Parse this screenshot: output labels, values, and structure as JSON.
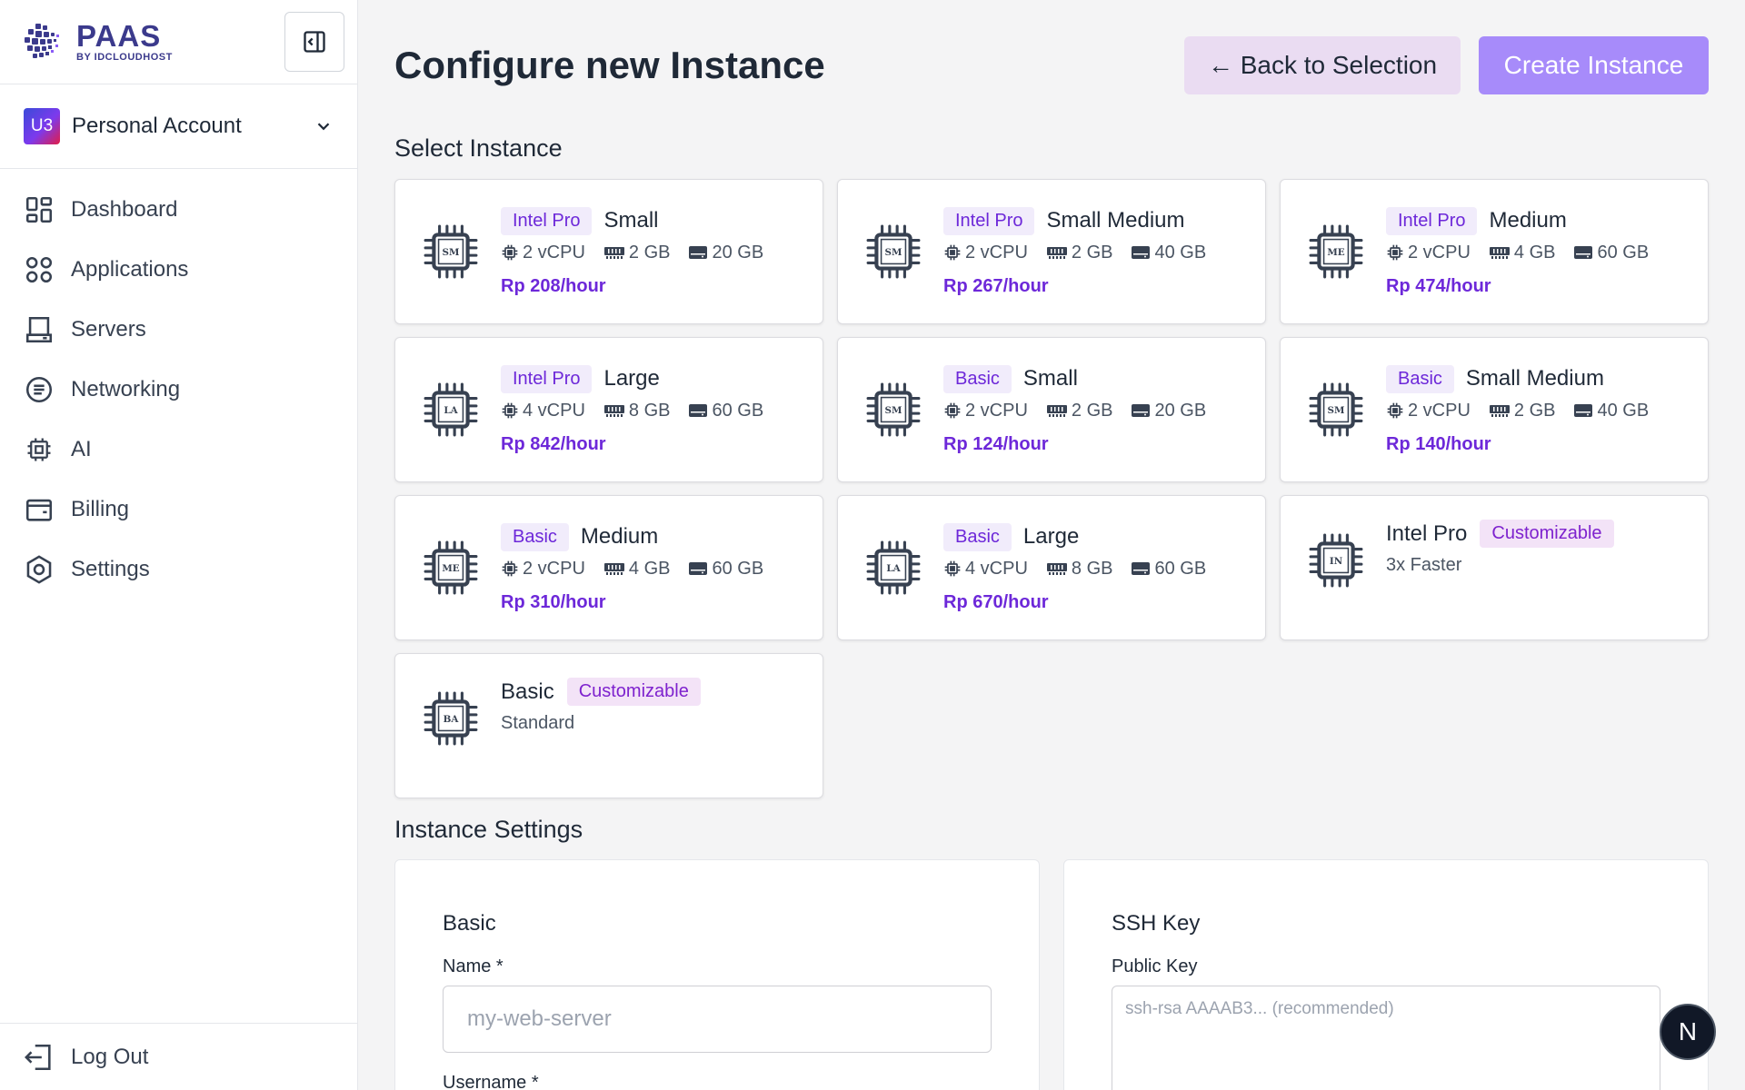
{
  "brand": {
    "name": "PAAS",
    "sub": "BY IDCLOUDHOST"
  },
  "account": {
    "initials": "U3",
    "name": "Personal Account"
  },
  "nav": [
    {
      "label": "Dashboard",
      "icon": "dashboard-icon"
    },
    {
      "label": "Applications",
      "icon": "applications-icon"
    },
    {
      "label": "Servers",
      "icon": "servers-icon"
    },
    {
      "label": "Networking",
      "icon": "networking-icon"
    },
    {
      "label": "AI",
      "icon": "cpu-icon"
    },
    {
      "label": "Billing",
      "icon": "wallet-icon"
    },
    {
      "label": "Settings",
      "icon": "settings-icon"
    }
  ],
  "logout_label": "Log Out",
  "page": {
    "title": "Configure new Instance",
    "back_label": "← Back to Selection",
    "create_label": "Create Instance",
    "select_title": "Select Instance",
    "settings_title": "Instance Settings"
  },
  "instances": [
    {
      "chip": "SM",
      "badge": "Intel Pro",
      "name": "Small",
      "cpu": "2 vCPU",
      "ram": "2 GB",
      "disk": "20 GB",
      "price": "Rp 208/hour"
    },
    {
      "chip": "SM",
      "badge": "Intel Pro",
      "name": "Small Medium",
      "cpu": "2 vCPU",
      "ram": "2 GB",
      "disk": "40 GB",
      "price": "Rp 267/hour"
    },
    {
      "chip": "ME",
      "badge": "Intel Pro",
      "name": "Medium",
      "cpu": "2 vCPU",
      "ram": "4 GB",
      "disk": "60 GB",
      "price": "Rp 474/hour"
    },
    {
      "chip": "LA",
      "badge": "Intel Pro",
      "name": "Large",
      "cpu": "4 vCPU",
      "ram": "8 GB",
      "disk": "60 GB",
      "price": "Rp 842/hour"
    },
    {
      "chip": "SM",
      "badge": "Basic",
      "name": "Small",
      "cpu": "2 vCPU",
      "ram": "2 GB",
      "disk": "20 GB",
      "price": "Rp 124/hour"
    },
    {
      "chip": "SM",
      "badge": "Basic",
      "name": "Small Medium",
      "cpu": "2 vCPU",
      "ram": "2 GB",
      "disk": "40 GB",
      "price": "Rp 140/hour"
    },
    {
      "chip": "ME",
      "badge": "Basic",
      "name": "Medium",
      "cpu": "2 vCPU",
      "ram": "4 GB",
      "disk": "60 GB",
      "price": "Rp 310/hour"
    },
    {
      "chip": "LA",
      "badge": "Basic",
      "name": "Large",
      "cpu": "4 vCPU",
      "ram": "8 GB",
      "disk": "60 GB",
      "price": "Rp 670/hour"
    }
  ],
  "custom_instances": [
    {
      "chip": "IN",
      "name": "Intel Pro",
      "badge": "Customizable",
      "subtitle": "3x Faster"
    },
    {
      "chip": "BA",
      "name": "Basic",
      "badge": "Customizable",
      "subtitle": "Standard"
    }
  ],
  "basic_settings": {
    "title": "Basic",
    "name_label": "Name *",
    "name_placeholder": "my-web-server",
    "username_label": "Username *"
  },
  "ssh_settings": {
    "title": "SSH Key",
    "key_label": "Public Key",
    "key_placeholder": "ssh-rsa AAAAB3... (recommended)"
  },
  "next_badge": "N",
  "colors": {
    "accent": "#a78bfa",
    "price": "#6d28d9",
    "back_button": "#eadcf2"
  }
}
